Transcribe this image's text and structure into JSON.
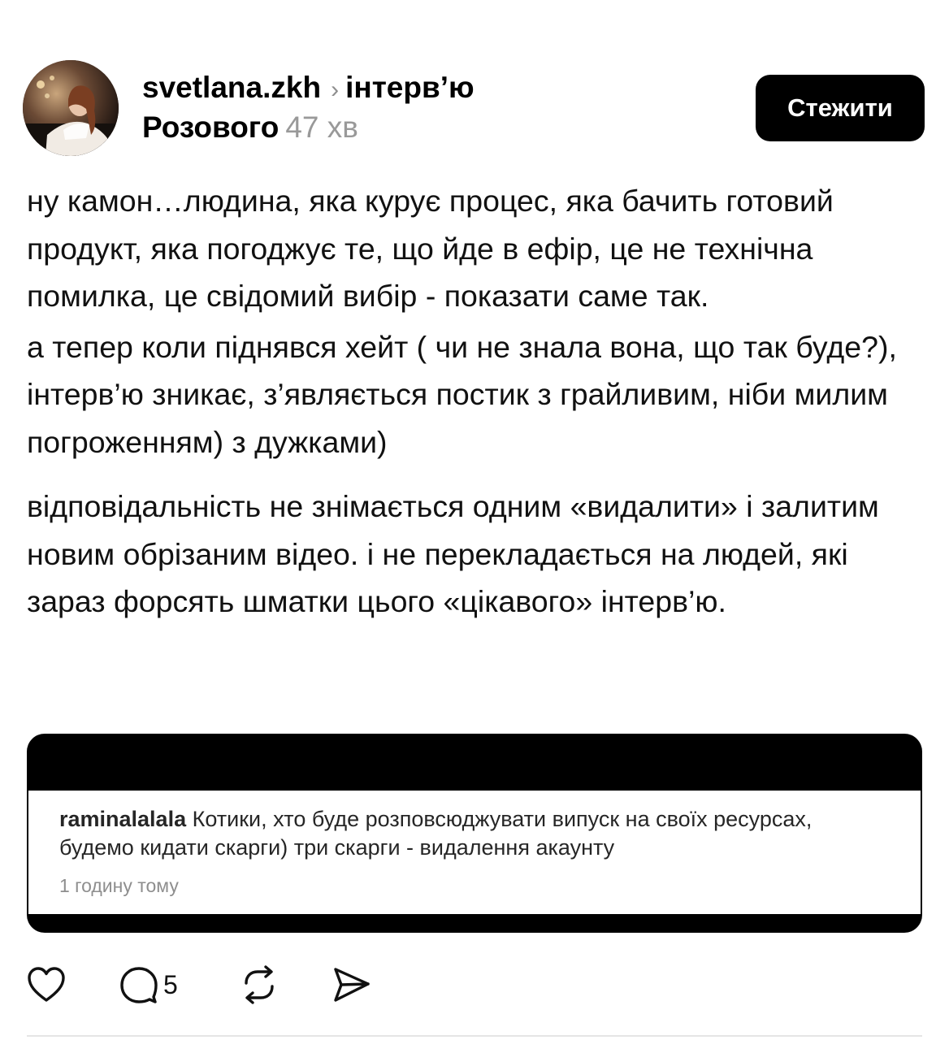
{
  "post": {
    "username": "svetlana.zkh",
    "topic_line1": "інтерв’ю",
    "topic_line2": "Розового",
    "time": "47 хв",
    "follow_label": "Стежити",
    "paragraphs": [
      "ну камон…людина, яка курує процес, яка бачить готовий продукт, яка погоджує те, що йде в ефір, це не технічна помилка, це свідомий вибір - показати саме так.",
      "а тепер коли піднявся хейт ( чи не знала вона, що так буде?), інтерв’ю зникає, з’являється постик з грайливим, ніби милим погроженням) з дужками)",
      "відповідальність не знімається одним «видалити» і залитим новим обрізаним відео. і не перекладається на людей, які зараз форсять шматки цього «цікавого» інтерв’ю."
    ],
    "embed": {
      "comment_user": "raminalalala",
      "comment_text": "Котики, хто буде розповсюджувати випуск на своїх ресурсах, будемо кидати скарги) три скарги - видалення акаунту",
      "comment_time": "1 годину тому"
    },
    "actions": {
      "like_icon": "heart-icon",
      "comment_icon": "comment-bubble-icon",
      "comment_count": "5",
      "repost_icon": "repost-icon",
      "share_icon": "send-icon"
    }
  }
}
